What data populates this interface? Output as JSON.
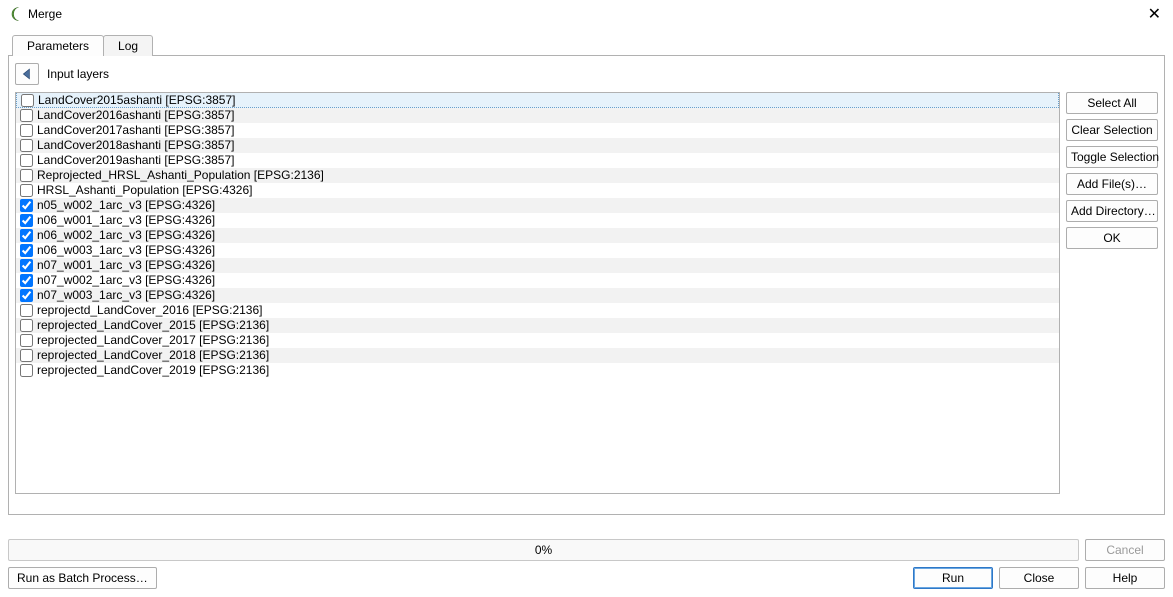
{
  "window": {
    "title": "Merge"
  },
  "tabs": {
    "parameters": "Parameters",
    "log": "Log"
  },
  "panel": {
    "heading": "Input layers"
  },
  "layers": [
    {
      "label": "LandCover2015ashanti [EPSG:3857]",
      "checked": false
    },
    {
      "label": "LandCover2016ashanti [EPSG:3857]",
      "checked": false
    },
    {
      "label": "LandCover2017ashanti [EPSG:3857]",
      "checked": false
    },
    {
      "label": "LandCover2018ashanti [EPSG:3857]",
      "checked": false
    },
    {
      "label": "LandCover2019ashanti [EPSG:3857]",
      "checked": false
    },
    {
      "label": "Reprojected_HRSL_Ashanti_Population [EPSG:2136]",
      "checked": false
    },
    {
      "label": "HRSL_Ashanti_Population [EPSG:4326]",
      "checked": false
    },
    {
      "label": "n05_w002_1arc_v3 [EPSG:4326]",
      "checked": true
    },
    {
      "label": "n06_w001_1arc_v3 [EPSG:4326]",
      "checked": true
    },
    {
      "label": "n06_w002_1arc_v3 [EPSG:4326]",
      "checked": true
    },
    {
      "label": "n06_w003_1arc_v3 [EPSG:4326]",
      "checked": true
    },
    {
      "label": "n07_w001_1arc_v3 [EPSG:4326]",
      "checked": true
    },
    {
      "label": "n07_w002_1arc_v3 [EPSG:4326]",
      "checked": true
    },
    {
      "label": "n07_w003_1arc_v3 [EPSG:4326]",
      "checked": true
    },
    {
      "label": "reprojectd_LandCover_2016 [EPSG:2136]",
      "checked": false
    },
    {
      "label": "reprojected_LandCover_2015 [EPSG:2136]",
      "checked": false
    },
    {
      "label": "reprojected_LandCover_2017 [EPSG:2136]",
      "checked": false
    },
    {
      "label": "reprojected_LandCover_2018 [EPSG:2136]",
      "checked": false
    },
    {
      "label": "reprojected_LandCover_2019 [EPSG:2136]",
      "checked": false
    }
  ],
  "side": {
    "select_all": "Select All",
    "clear_selection": "Clear Selection",
    "toggle_selection": "Toggle Selection",
    "add_files": "Add File(s)…",
    "add_directory": "Add Directory…",
    "ok": "OK"
  },
  "footer": {
    "progress": "0%",
    "cancel": "Cancel",
    "batch": "Run as Batch Process…",
    "run": "Run",
    "close": "Close",
    "help": "Help"
  }
}
